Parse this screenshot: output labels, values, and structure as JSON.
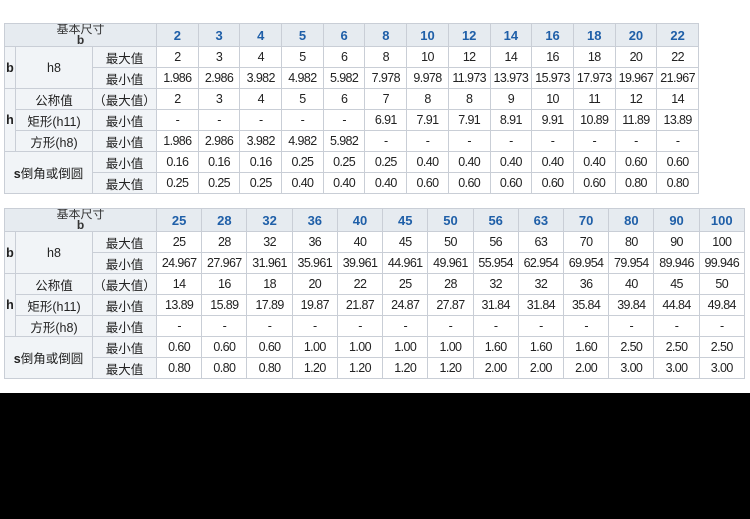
{
  "tables": [
    {
      "header_label_top": "基本尺寸",
      "header_label_bottom": "b",
      "sizes": [
        "2",
        "3",
        "4",
        "5",
        "6",
        "8",
        "10",
        "12",
        "14",
        "16",
        "18",
        "20",
        "22"
      ],
      "b_symbol": "b",
      "b_tol": "h8",
      "b_max_label": "最大值",
      "b_max": [
        "2",
        "3",
        "4",
        "5",
        "6",
        "8",
        "10",
        "12",
        "14",
        "16",
        "18",
        "20",
        "22"
      ],
      "b_min_label": "最小值",
      "b_min": [
        "1.986",
        "2.986",
        "3.982",
        "4.982",
        "5.982",
        "7.978",
        "9.978",
        "11.973",
        "13.973",
        "15.973",
        "17.973",
        "19.967",
        "21.967"
      ],
      "h_symbol": "h",
      "nominal_label": "公称值",
      "nominal_sub": "（最大值）",
      "h_nominal": [
        "2",
        "3",
        "4",
        "5",
        "6",
        "7",
        "8",
        "8",
        "9",
        "10",
        "11",
        "12",
        "14"
      ],
      "rect_label": "矩形(h11)",
      "rect_min_label": "最小值",
      "h_rect_min": [
        "-",
        "-",
        "-",
        "-",
        "-",
        "6.91",
        "7.91",
        "7.91",
        "8.91",
        "9.91",
        "10.89",
        "11.89",
        "13.89"
      ],
      "square_label": "方形(h8)",
      "square_min_label": "最小值",
      "h_square_min": [
        "1.986",
        "2.986",
        "3.982",
        "4.982",
        "5.982",
        "-",
        "-",
        "-",
        "-",
        "-",
        "-",
        "-",
        "-"
      ],
      "s_symbol": "s",
      "chamfer_label": "倒角或倒圆",
      "s_min_label": "最小值",
      "s_min": [
        "0.16",
        "0.16",
        "0.16",
        "0.25",
        "0.25",
        "0.25",
        "0.40",
        "0.40",
        "0.40",
        "0.40",
        "0.40",
        "0.60",
        "0.60"
      ],
      "s_max_label": "最大值",
      "s_max": [
        "0.25",
        "0.25",
        "0.25",
        "0.40",
        "0.40",
        "0.40",
        "0.60",
        "0.60",
        "0.60",
        "0.60",
        "0.60",
        "0.80",
        "0.80"
      ]
    },
    {
      "header_label_top": "基本尺寸",
      "header_label_bottom": "b",
      "sizes": [
        "25",
        "28",
        "32",
        "36",
        "40",
        "45",
        "50",
        "56",
        "63",
        "70",
        "80",
        "90",
        "100"
      ],
      "b_symbol": "b",
      "b_tol": "h8",
      "b_max_label": "最大值",
      "b_max": [
        "25",
        "28",
        "32",
        "36",
        "40",
        "45",
        "50",
        "56",
        "63",
        "70",
        "80",
        "90",
        "100"
      ],
      "b_min_label": "最小值",
      "b_min": [
        "24.967",
        "27.967",
        "31.961",
        "35.961",
        "39.961",
        "44.961",
        "49.961",
        "55.954",
        "62.954",
        "69.954",
        "79.954",
        "89.946",
        "99.946"
      ],
      "h_symbol": "h",
      "nominal_label": "公称值",
      "nominal_sub": "（最大值）",
      "h_nominal": [
        "14",
        "16",
        "18",
        "20",
        "22",
        "25",
        "28",
        "32",
        "32",
        "36",
        "40",
        "45",
        "50"
      ],
      "rect_label": "矩形(h11)",
      "rect_min_label": "最小值",
      "h_rect_min": [
        "13.89",
        "15.89",
        "17.89",
        "19.87",
        "21.87",
        "24.87",
        "27.87",
        "31.84",
        "31.84",
        "35.84",
        "39.84",
        "44.84",
        "49.84"
      ],
      "square_label": "方形(h8)",
      "square_min_label": "最小值",
      "h_square_min": [
        "-",
        "-",
        "-",
        "-",
        "-",
        "-",
        "-",
        "-",
        "-",
        "-",
        "-",
        "-",
        "-"
      ],
      "s_symbol": "s",
      "chamfer_label": "倒角或倒圆",
      "s_min_label": "最小值",
      "s_min": [
        "0.60",
        "0.60",
        "0.60",
        "1.00",
        "1.00",
        "1.00",
        "1.00",
        "1.60",
        "1.60",
        "1.60",
        "2.50",
        "2.50",
        "2.50"
      ],
      "s_max_label": "最大值",
      "s_max": [
        "0.80",
        "0.80",
        "0.80",
        "1.20",
        "1.20",
        "1.20",
        "1.20",
        "2.00",
        "2.00",
        "2.00",
        "3.00",
        "3.00",
        "3.00"
      ]
    }
  ]
}
